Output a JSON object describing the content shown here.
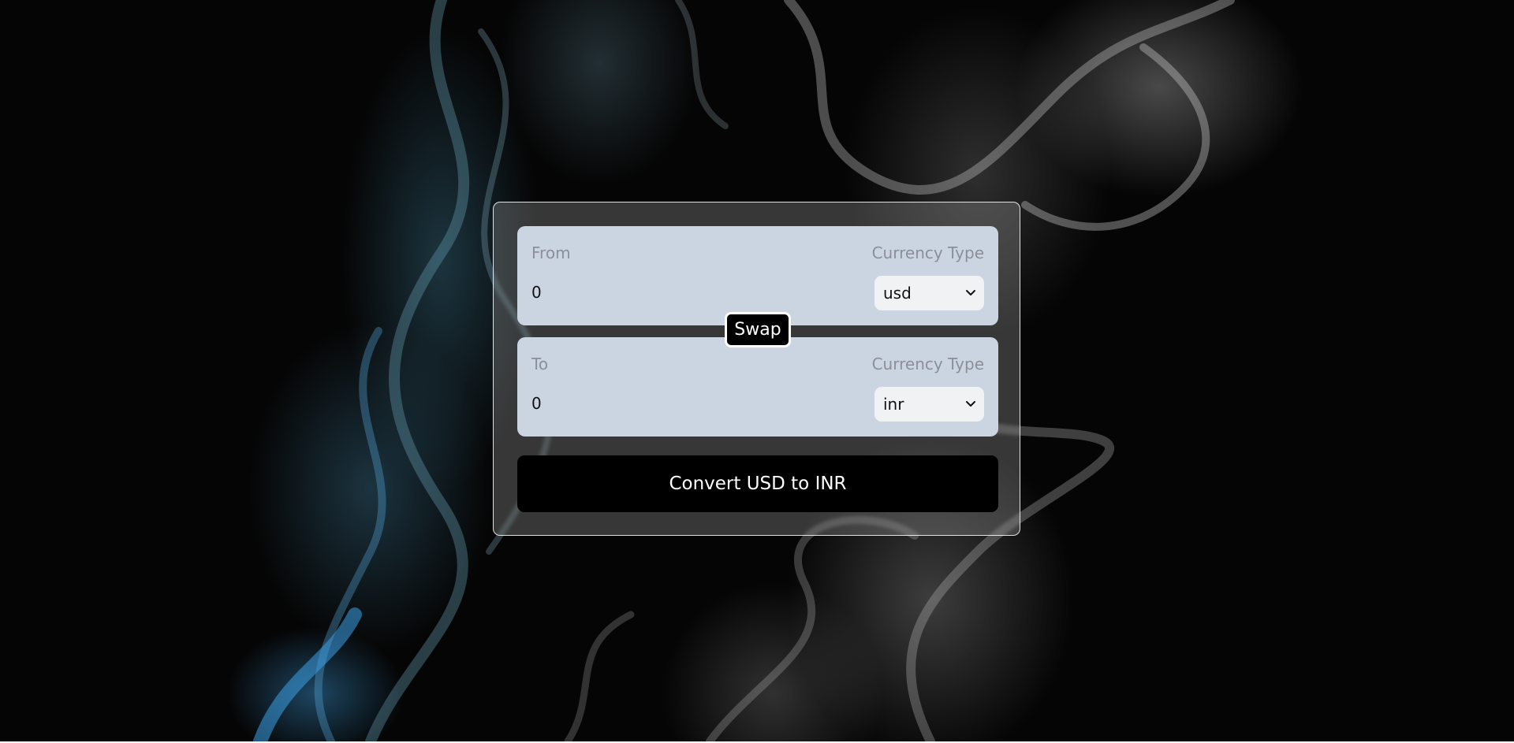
{
  "converter": {
    "from": {
      "label": "From",
      "currency_type_label": "Currency Type",
      "amount": "0",
      "currency": "usd"
    },
    "to": {
      "label": "To",
      "currency_type_label": "Currency Type",
      "amount": "0",
      "currency": "inr"
    },
    "swap_label": "Swap",
    "convert_label": "Convert USD to INR"
  },
  "colors": {
    "panel": "#cbd5e1",
    "button": "#000000",
    "select_bg": "#f1f2f4"
  }
}
